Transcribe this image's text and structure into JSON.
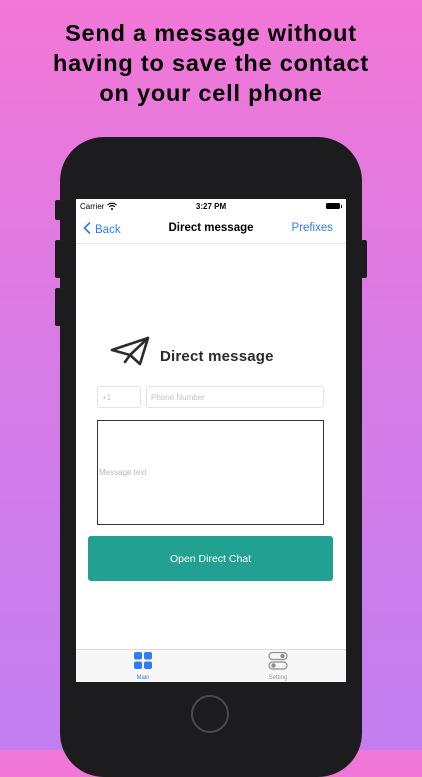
{
  "headline": {
    "line1": "Send a message without",
    "line2": "having to save the contact",
    "line3": "on your cell phone"
  },
  "status_bar": {
    "carrier": "Carrier",
    "time": "3:27 PM"
  },
  "nav": {
    "back_label": "Back",
    "title": "Direct message",
    "prefixes_label": "Prefixes"
  },
  "brand": {
    "title": "Direct message",
    "icon": "paper-plane-icon"
  },
  "form": {
    "country_code_placeholder": "+1",
    "phone_placeholder": "Phone Number",
    "message_placeholder": "Message text",
    "open_button_label": "Open Direct Chat"
  },
  "tabs": [
    {
      "label": "Main",
      "icon": "grid-icon",
      "active": true
    },
    {
      "label": "Setting",
      "icon": "toggles-icon",
      "active": false
    }
  ],
  "colors": {
    "accent_blue": "#2f7cf6",
    "button_teal": "#22a192",
    "bg_top": "#f277d6",
    "bg_bottom": "#c27ef0"
  }
}
